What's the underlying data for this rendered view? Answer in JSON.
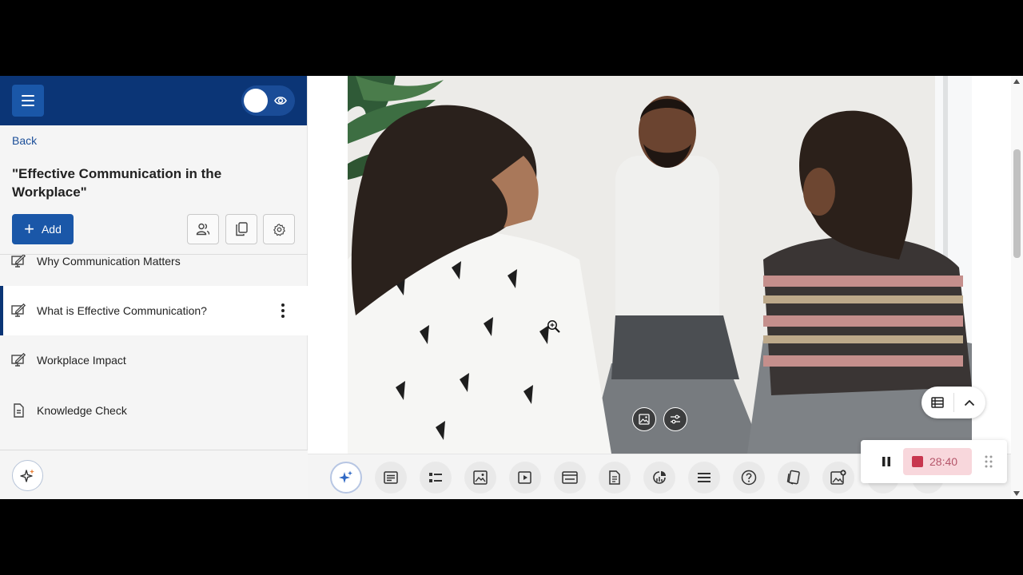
{
  "sidebar": {
    "back_label": "Back",
    "course_title": "\"Effective Communication in the Workplace\"",
    "add_label": "Add",
    "items": [
      {
        "label": "Why Communication Matters",
        "icon": "lesson-edit-icon"
      },
      {
        "label": "What is Effective Communication?",
        "icon": "lesson-edit-icon",
        "active": true
      },
      {
        "label": "Workplace Impact",
        "icon": "lesson-edit-icon"
      },
      {
        "label": "Knowledge Check",
        "icon": "document-icon"
      }
    ]
  },
  "toolbar": {
    "icons": [
      "ai-sparkle-icon",
      "text-block-icon",
      "list-block-icon",
      "image-block-icon",
      "video-block-icon",
      "browser-embed-icon",
      "document-block-icon",
      "chart-block-icon",
      "divider-block-icon",
      "question-block-icon",
      "flashcards-icon",
      "image-add-icon"
    ]
  },
  "recorder": {
    "time": "28:40"
  },
  "colors": {
    "header_navy": "#0b3576",
    "primary_blue": "#1a57a8",
    "record_red": "#c8374f"
  }
}
